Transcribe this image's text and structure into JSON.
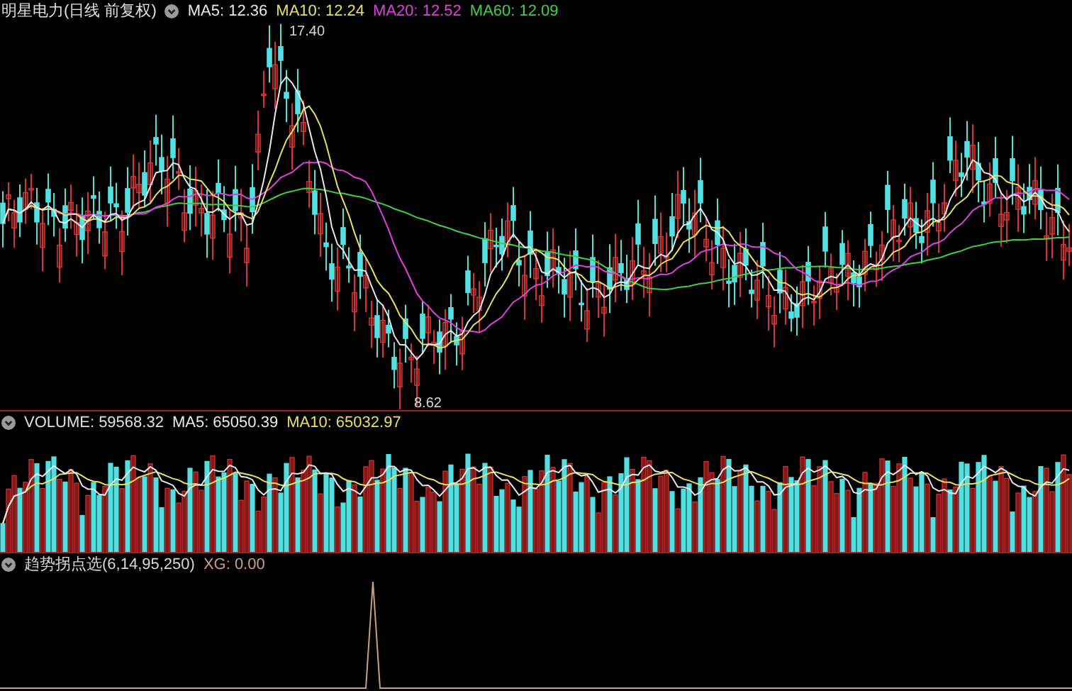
{
  "title": "明星电力(日线 前复权)",
  "main_panel": {
    "indicators": [
      {
        "text": "MA5: 12.36",
        "color": "#e8e8e8"
      },
      {
        "text": "MA10: 12.24",
        "color": "#e8e060"
      },
      {
        "text": "MA20: 12.52",
        "color": "#e040e0"
      },
      {
        "text": "MA60: 12.09",
        "color": "#40d040"
      }
    ],
    "high_label": "17.40",
    "low_label": "8.62"
  },
  "volume_panel": {
    "indicators": [
      {
        "text": "VOLUME: 59568.32",
        "color": "#e0e0e0"
      },
      {
        "text": "MA5: 65050.39",
        "color": "#e8e8e8"
      },
      {
        "text": "MA10: 65032.97",
        "color": "#e8e060"
      }
    ]
  },
  "indicator_panel": {
    "name": "趋势拐点选(6,14,95,250)",
    "indicators": [
      {
        "text": "XG: 0.00",
        "color": "#c8a080"
      }
    ]
  }
}
